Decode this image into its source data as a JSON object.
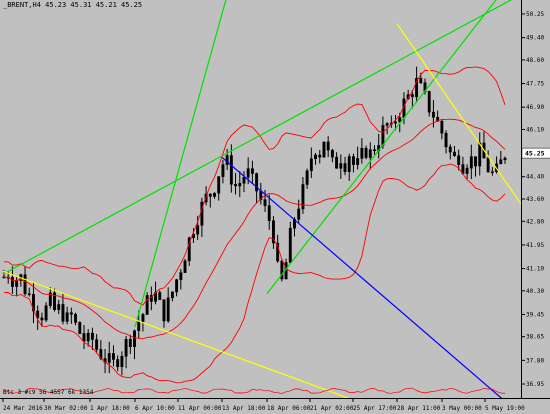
{
  "header": {
    "text": "_BRENT,H4  45.23 45.31 45.21 45.25"
  },
  "indicator_label": "Btc 3 #c9 56 4557 6k 1354",
  "price_axis": {
    "labels": [
      "50.25",
      "49.40",
      "48.60",
      "47.75",
      "46.90",
      "46.10",
      "45.25",
      "44.40",
      "43.60",
      "42.80",
      "41.95",
      "41.10",
      "40.30",
      "39.45",
      "38.65",
      "37.80",
      "36.95"
    ],
    "current": "45.25"
  },
  "time_axis": {
    "labels": [
      "24 Mar 2016",
      "30 Mar 02:00",
      "1 Apr 18:00",
      "6 Apr 10:00",
      "11 Apr 00:00",
      "13 Apr 18:00",
      "18 Apr 06:00",
      "21 Apr 02:00",
      "25 Apr 17:00",
      "28 Apr 11:00",
      "3 May 00:00",
      "5 May 19:00"
    ]
  },
  "chart_data": {
    "type": "candlestick",
    "symbol": "_BRENT",
    "timeframe": "H4",
    "ylim": [
      36.95,
      50.25
    ],
    "ohlc_last": {
      "open": 45.23,
      "high": 45.31,
      "low": 45.21,
      "close": 45.25
    },
    "close_path": [
      40.8,
      41.0,
      40.6,
      40.9,
      40.4,
      40.1,
      39.8,
      39.4,
      39.6,
      39.9,
      39.5,
      39.7,
      39.2,
      39.4,
      39.0,
      38.7,
      38.4,
      38.6,
      38.2,
      38.0,
      37.8,
      37.6,
      37.9,
      38.2,
      38.5,
      38.8,
      39.2,
      39.5,
      40.0,
      40.3,
      39.8,
      39.5,
      39.9,
      40.5,
      41.0,
      41.6,
      42.2,
      42.8,
      43.2,
      43.6,
      43.8,
      44.2,
      44.8,
      45.0,
      44.4,
      44.0,
      44.3,
      44.6,
      44.2,
      43.9,
      43.4,
      43.0,
      42.6,
      41.0,
      40.5,
      41.8,
      42.8,
      43.4,
      43.9,
      44.6,
      45.6,
      45.2,
      45.8,
      45.0,
      44.7,
      45.2,
      44.9,
      45.3,
      44.6,
      45.0,
      45.4,
      45.2,
      45.6,
      45.9,
      46.3,
      46.0,
      46.6,
      46.9,
      47.2,
      47.5,
      47.8,
      47.4,
      47.0,
      46.7,
      46.3,
      45.9,
      45.4,
      45.0,
      45.2,
      44.8,
      45.1,
      44.9,
      45.3,
      45.0,
      44.6,
      44.4,
      44.8,
      45.25
    ],
    "trendlines": [
      {
        "color": "#00e000",
        "from": [
          "24 Mar 2016",
          40.9
        ],
        "to": [
          "5 May 19:00",
          50.25
        ]
      },
      {
        "color": "#00e000",
        "from": [
          "6 Apr 10:00",
          39.0
        ],
        "to": [
          "13 Apr 18:00",
          50.25
        ]
      },
      {
        "color": "#00e000",
        "from": [
          "18 Apr 06:00",
          40.2
        ],
        "to": [
          "5 May 19:00",
          50.25
        ]
      },
      {
        "color": "#ffff00",
        "from": [
          "24 Mar 2016",
          41.0
        ],
        "to": [
          "21 Apr 02:00",
          36.95
        ]
      },
      {
        "color": "#ffff00",
        "from": [
          "28 Apr 11:00",
          49.9
        ],
        "to": [
          "5 May 19:00",
          45.3
        ]
      },
      {
        "color": "#0000ff",
        "from": [
          "13 Apr 18:00",
          45.1
        ],
        "to": [
          "5 May 19:00",
          36.95
        ]
      }
    ],
    "bands": "bollinger",
    "grid": false
  },
  "colors": {
    "background": "#c0c0c0",
    "candle": "#000000",
    "band": "#ff0000",
    "green_line": "#00e000",
    "yellow_line": "#ffff00",
    "blue_line": "#0000ff"
  }
}
